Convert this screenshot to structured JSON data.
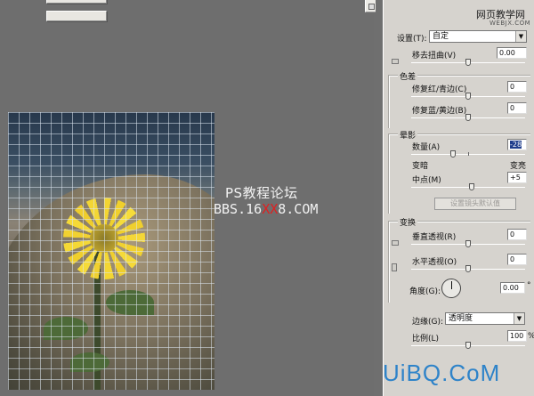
{
  "watermarks": {
    "forum_title": "PS教程论坛",
    "forum_url_prefix": "BBS.16",
    "forum_url_red": "XX",
    "forum_url_suffix": "8.COM",
    "site_name": "网页教学网",
    "site_url": "WEBJX.COM",
    "logo": "UiBQ.CoM"
  },
  "colors": {
    "panel_bg": "#d6d3ce",
    "canvas_bg": "#6f6f6f",
    "logo_blue": "#2e83c9",
    "selection": "#1f3d8c",
    "watermark_red": "#e02020"
  },
  "settings": {
    "label": "设置",
    "shortcut": "(T):",
    "value": "自定"
  },
  "distortion": {
    "label": "移去扭曲",
    "shortcut": "(V)",
    "value": "0.00"
  },
  "chromatic": {
    "title": "色差",
    "red_cyan": {
      "label": "修复红/青边",
      "shortcut": "(C)",
      "value": "0"
    },
    "blue_yellow": {
      "label": "修复蓝/黄边",
      "shortcut": "(B)",
      "value": "0"
    }
  },
  "vignette": {
    "title": "晕影",
    "amount": {
      "label": "数量",
      "shortcut": "(A)",
      "value": "-28"
    },
    "darken": "变暗",
    "lighten": "变亮",
    "midpoint": {
      "label": "中点",
      "shortcut": "(M)",
      "value": "+5"
    },
    "defaults_button": "设置镜头默认值"
  },
  "transform": {
    "title": "变换",
    "vertical": {
      "label": "垂直透视",
      "shortcut": "(R)",
      "value": "0"
    },
    "horizontal": {
      "label": "水平透视",
      "shortcut": "(O)",
      "value": "0"
    },
    "angle": {
      "label": "角度",
      "shortcut": "(G):",
      "value": "0.00",
      "unit": "°"
    },
    "edge": {
      "label": "边缘",
      "shortcut": "(G):",
      "value": "透明度"
    },
    "scale": {
      "label": "比例",
      "shortcut": "(L)",
      "value": "100",
      "unit": "%"
    }
  },
  "slider_levels": {
    "distortion": 0.5,
    "red_cyan": 0.5,
    "blue_yellow": 0.5,
    "amount": 0.36,
    "midpoint": 0.53,
    "vertical": 0.5,
    "horizontal": 0.5,
    "scale": 0.5
  },
  "icons": [
    "distortion-grid-icon",
    "vertical-perspective-icon",
    "horizontal-perspective-icon",
    "angle-dial-icon",
    "dropdown-arrow-icon"
  ]
}
